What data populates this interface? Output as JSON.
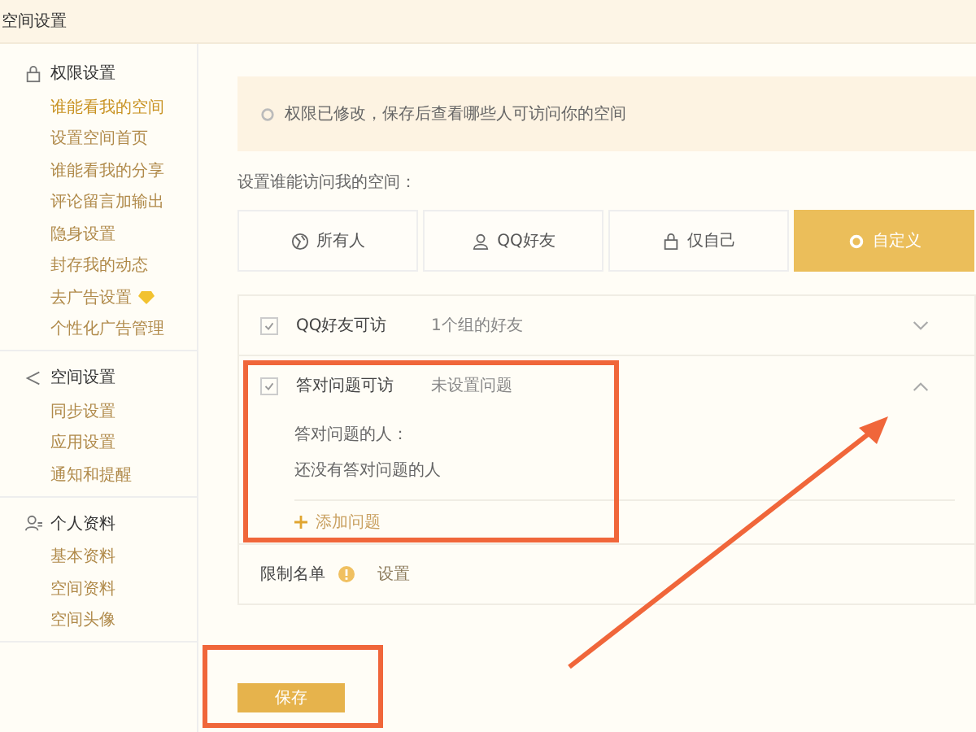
{
  "header": {
    "title": "空间设置"
  },
  "sidebar": {
    "groups": [
      {
        "title": "权限设置",
        "items": [
          {
            "label": "谁能看我的空间",
            "selected": true
          },
          {
            "label": "设置空间首页",
            "selected": false
          },
          {
            "label": "谁能看我的分享",
            "selected": false
          },
          {
            "label": "评论留言加输出",
            "selected": false
          },
          {
            "label": "隐身设置",
            "selected": false
          },
          {
            "label": "封存我的动态",
            "selected": false
          },
          {
            "label": "去广告设置",
            "selected": false,
            "badge": true
          },
          {
            "label": "个性化广告管理",
            "selected": false
          }
        ]
      },
      {
        "title": "空间设置",
        "items": [
          {
            "label": "同步设置",
            "selected": false
          },
          {
            "label": "应用设置",
            "selected": false
          },
          {
            "label": "通知和提醒",
            "selected": false
          }
        ]
      },
      {
        "title": "个人资料",
        "items": [
          {
            "label": "基本资料",
            "selected": false
          },
          {
            "label": "空间资料",
            "selected": false
          },
          {
            "label": "空间头像",
            "selected": false
          }
        ]
      }
    ]
  },
  "notice": {
    "text": "权限已修改，保存后查看哪些人可访问你的空间"
  },
  "access_label": "设置谁能访问我的空间：",
  "options": [
    {
      "label": "所有人",
      "selected": false
    },
    {
      "label": "QQ好友",
      "selected": false
    },
    {
      "label": "仅自己",
      "selected": false
    },
    {
      "label": "自定义",
      "selected": true
    }
  ],
  "rules": [
    {
      "title": "QQ好友可访",
      "summary": "1个组的好友",
      "checked": true,
      "expanded": false
    },
    {
      "title": "答对问题可访",
      "summary": "未设置问题",
      "checked": true,
      "expanded": true,
      "detail_label": "答对问题的人：",
      "detail_empty": "还没有答对问题的人",
      "add_label": "添加问题"
    }
  ],
  "blocklist": {
    "label": "限制名单",
    "link": "设置"
  },
  "save_button": "保存"
}
